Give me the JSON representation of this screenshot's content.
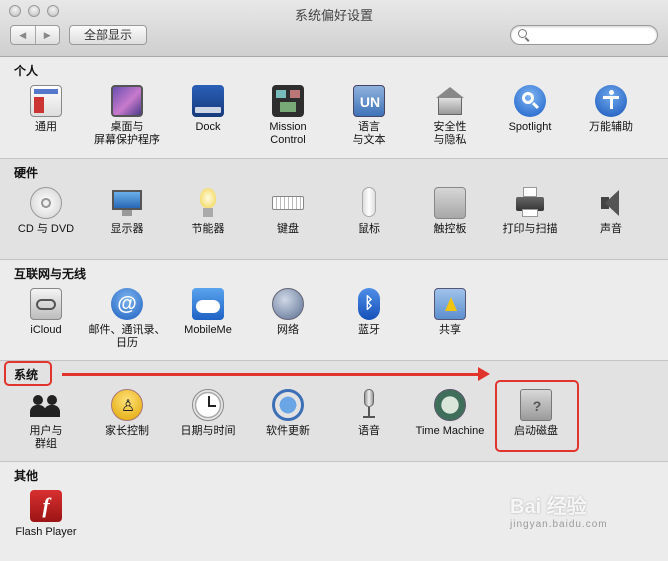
{
  "window": {
    "title": "系统偏好设置"
  },
  "toolbar": {
    "back": "◀",
    "forward": "▶",
    "show_all": "全部显示",
    "search_value": ""
  },
  "sections": [
    {
      "title": "个人",
      "items": [
        {
          "label": "通用",
          "icon": "general-icon"
        },
        {
          "label": "桌面与\n屏幕保护程序",
          "icon": "desktop-icon"
        },
        {
          "label": "Dock",
          "icon": "dock-icon"
        },
        {
          "label": "Mission\nControl",
          "icon": "mission-control-icon"
        },
        {
          "label": "语言\n与文本",
          "icon": "language-icon"
        },
        {
          "label": "安全性\n与隐私",
          "icon": "security-icon"
        },
        {
          "label": "Spotlight",
          "icon": "spotlight-icon"
        },
        {
          "label": "万能辅助",
          "icon": "accessibility-icon"
        }
      ]
    },
    {
      "title": "硬件",
      "items": [
        {
          "label": "CD 与 DVD",
          "icon": "cd-icon"
        },
        {
          "label": "显示器",
          "icon": "display-icon"
        },
        {
          "label": "节能器",
          "icon": "energy-icon"
        },
        {
          "label": "键盘",
          "icon": "keyboard-icon"
        },
        {
          "label": "鼠标",
          "icon": "mouse-icon"
        },
        {
          "label": "触控板",
          "icon": "trackpad-icon"
        },
        {
          "label": "打印与扫描",
          "icon": "printer-icon"
        },
        {
          "label": "声音",
          "icon": "sound-icon"
        }
      ]
    },
    {
      "title": "互联网与无线",
      "items": [
        {
          "label": "iCloud",
          "icon": "icloud-icon"
        },
        {
          "label": "邮件、通讯录、\n日历",
          "icon": "mail-icon"
        },
        {
          "label": "MobileMe",
          "icon": "mobileme-icon"
        },
        {
          "label": "网络",
          "icon": "network-icon"
        },
        {
          "label": "蓝牙",
          "icon": "bluetooth-icon"
        },
        {
          "label": "共享",
          "icon": "sharing-icon"
        }
      ]
    },
    {
      "title": "系统",
      "items": [
        {
          "label": "用户与\n群组",
          "icon": "users-icon"
        },
        {
          "label": "家长控制",
          "icon": "parental-icon"
        },
        {
          "label": "日期与时间",
          "icon": "datetime-icon"
        },
        {
          "label": "软件更新",
          "icon": "update-icon"
        },
        {
          "label": "语音",
          "icon": "speech-icon"
        },
        {
          "label": "Time Machine",
          "icon": "timemachine-icon"
        },
        {
          "label": "启动磁盘",
          "icon": "startup-disk-icon"
        }
      ]
    },
    {
      "title": "其他",
      "items": [
        {
          "label": "Flash Player",
          "icon": "flash-icon"
        }
      ]
    }
  ],
  "watermark": {
    "text": "Bai 经验",
    "sub": "jingyan.baidu.com"
  },
  "colors": {
    "highlight": "#e0342c"
  }
}
